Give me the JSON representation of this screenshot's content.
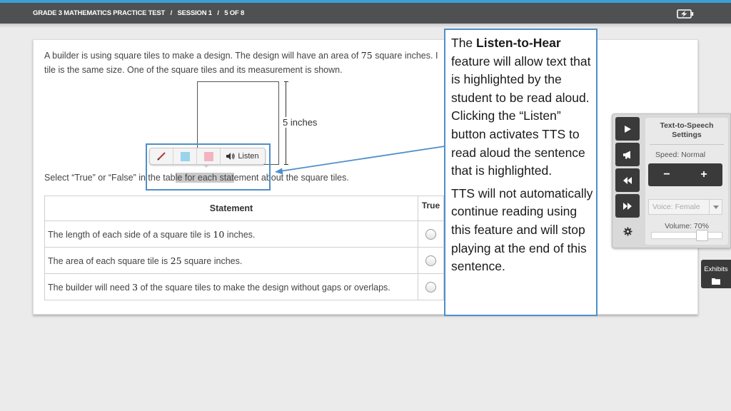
{
  "header": {
    "test_title": "GRADE 3 MATHEMATICS PRACTICE TEST",
    "separator": "/",
    "session": "SESSION 1",
    "position": "5 OF 8",
    "battery_icon": "battery-charging-icon"
  },
  "question": {
    "line1_pre": "A builder is using square tiles to make a design. The design will have an area of",
    "line1_num": "75",
    "line1_post": "square inches. I",
    "line2": "tile is the same size. One of the square tiles and its measurement is shown.",
    "dimension_label": "5 inches"
  },
  "highlight_toolbar": {
    "pen_icon": "pen-icon",
    "blue_swatch_color": "#9ad3ec",
    "pink_swatch_color": "#f4b3c0",
    "listen_icon": "speaker-icon",
    "listen_label": "Listen"
  },
  "instruction": {
    "pre": "Select “True” or “False” in the tab",
    "highlighted": "le for each stat",
    "post": "ement about the square tiles."
  },
  "table": {
    "headers": [
      "Statement",
      "True"
    ],
    "rows": [
      {
        "pre": "The length of each side of a square tile is",
        "num": "10",
        "post": "inches."
      },
      {
        "pre": "The area of each square tile is",
        "num": "25",
        "post": "square inches."
      },
      {
        "pre": "The builder will need",
        "num": "3",
        "post": "of the square tiles to make the design without gaps or overlaps."
      }
    ]
  },
  "callout": {
    "p1_pre": "The",
    "p1_bold": "Listen-to-Hear",
    "p1_post": "feature will allow text that is highlighted by the student to be read aloud. Clicking the “Listen” button activates TTS to read aloud the sentence that is highlighted.",
    "p2": "TTS will not automatically continue reading using this feature and will stop playing at the end of this sentence."
  },
  "tts_panel": {
    "buttons": [
      "play-icon",
      "megaphone-icon",
      "rewind-icon",
      "fast-forward-icon",
      "gear-icon"
    ],
    "title": "Text-to-Speech Settings",
    "speed_label": "Speed: Normal",
    "minus": "−",
    "plus": "+",
    "voice_label": "Voice: Female",
    "volume_label": "Volume: 70%",
    "volume_percent": 70
  },
  "exhibits": {
    "label": "Exhibits",
    "icon": "folder-icon"
  },
  "colors": {
    "accent_blue": "#4f8fc9",
    "topbar": "#4f5052",
    "topbar_stripe": "#3a9fd6"
  }
}
